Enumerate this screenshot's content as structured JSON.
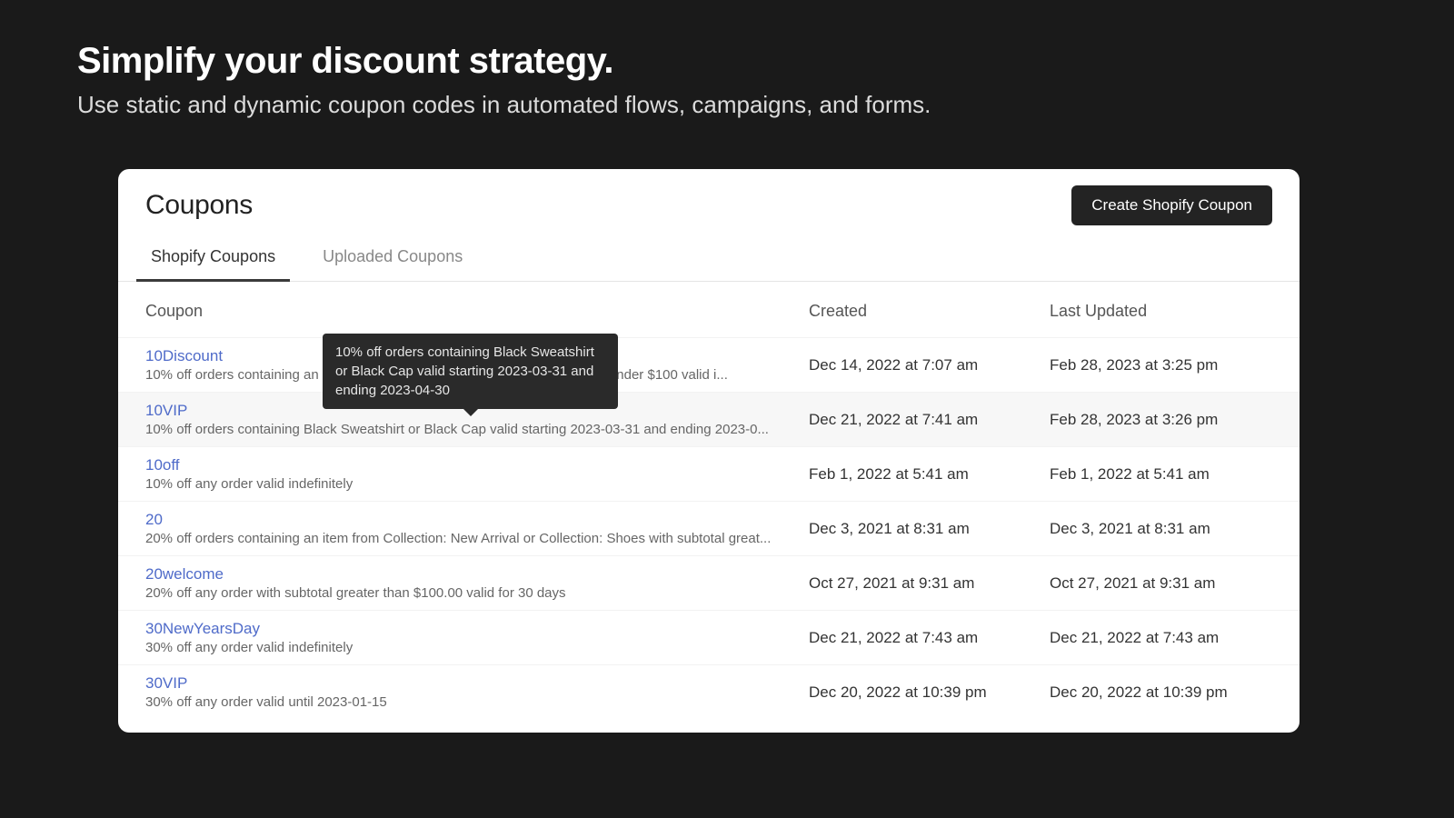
{
  "hero": {
    "title": "Simplify your discount strategy.",
    "subtitle": "Use static and dynamic coupon codes in automated flows, campaigns, and forms."
  },
  "panel": {
    "title": "Coupons",
    "create_button": "Create Shopify Coupon"
  },
  "tabs": [
    {
      "label": "Shopify Coupons",
      "active": true
    },
    {
      "label": "Uploaded Coupons",
      "active": false
    }
  ],
  "columns": {
    "coupon": "Coupon",
    "created": "Created",
    "updated": "Last Updated"
  },
  "tooltip": "10% off orders containing Black Sweatshirt or Black Cap valid starting 2023-03-31 and ending 2023-04-30",
  "rows": [
    {
      "name": "10Discount",
      "desc": "10% off orders containing an item from Collection: New Arrival or Collection: Under $100 valid i...",
      "created": "Dec 14, 2022 at 7:07 am",
      "updated": "Feb 28, 2023 at 3:25 pm"
    },
    {
      "name": "10VIP",
      "desc": "10% off orders containing Black Sweatshirt or Black Cap valid starting 2023-03-31 and ending 2023-0...",
      "created": "Dec 21, 2022 at 7:41 am",
      "updated": "Feb 28, 2023 at 3:26 pm"
    },
    {
      "name": "10off",
      "desc": "10% off any order valid indefinitely",
      "created": "Feb 1, 2022 at 5:41 am",
      "updated": "Feb 1, 2022 at 5:41 am"
    },
    {
      "name": "20",
      "desc": "20% off orders containing an item from Collection: New Arrival or Collection: Shoes with subtotal great...",
      "created": "Dec 3, 2021 at 8:31 am",
      "updated": "Dec 3, 2021 at 8:31 am"
    },
    {
      "name": "20welcome",
      "desc": "20% off any order with subtotal greater than $100.00 valid for 30 days",
      "created": "Oct 27, 2021 at 9:31 am",
      "updated": "Oct 27, 2021 at 9:31 am"
    },
    {
      "name": "30NewYearsDay",
      "desc": "30% off any order valid indefinitely",
      "created": "Dec 21, 2022 at 7:43 am",
      "updated": "Dec 21, 2022 at 7:43 am"
    },
    {
      "name": "30VIP",
      "desc": "30% off any order valid until 2023-01-15",
      "created": "Dec 20, 2022 at 10:39 pm",
      "updated": "Dec 20, 2022 at 10:39 pm"
    }
  ]
}
